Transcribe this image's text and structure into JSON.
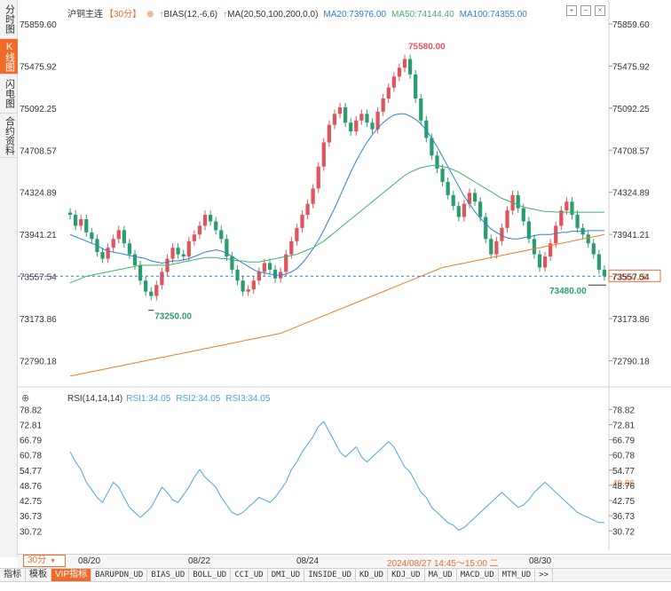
{
  "left_tabs": [
    {
      "label": "分时图",
      "active": false
    },
    {
      "label": "K线图",
      "active": true
    },
    {
      "label": "闪电图",
      "active": false
    },
    {
      "label": "合约资料",
      "active": false
    }
  ],
  "main_legend": {
    "title": "沪铜主连",
    "period": "【30分】",
    "bias": "BIAS(12,-6,6)",
    "ma": "MA(20,50,100,200,0,0)",
    "ma20": "MA20:73976.00",
    "ma50": "MA50:74144.40",
    "ma100": "MA100:74355.00"
  },
  "rsi_legend": {
    "name": "RSI(14,14,14)",
    "rsi1": "RSI1:34.05",
    "rsi2": "RSI2:34.05",
    "rsi3": "RSI3:34.05"
  },
  "colors": {
    "up": "#e0545d",
    "down": "#2a9d6f",
    "ma20": "#2b80d6",
    "ma50": "#3fb26a",
    "ma100": "#2b80d6",
    "ma200": "#f07c1f",
    "rsi": "#4aa3df",
    "accent": "#f06a2a"
  },
  "price_axis": [
    "75859.60",
    "75475.92",
    "75092.25",
    "74708.57",
    "74324.89",
    "73941.21",
    "73557.54",
    "73173.86",
    "72790.18"
  ],
  "rsi_axis": [
    "78.82",
    "72.81",
    "66.79",
    "60.78",
    "54.77",
    "48.76",
    "42.75",
    "36.73",
    "30.72"
  ],
  "current_price": "73560.00",
  "current_rsi": "49.86",
  "high_label": "75580.00",
  "low_label": "73250.00",
  "last_low_label": "73480.00",
  "dates": [
    "08/20",
    "08/22",
    "08/24",
    "08/30"
  ],
  "cursor_time": "2024/08/27  14:45～15:00 二",
  "period_button": "30分",
  "indicator_tabs": [
    {
      "label": "指标",
      "active": false
    },
    {
      "label": "模板",
      "active": false
    },
    {
      "label": "VIP指标",
      "active": true
    },
    {
      "label": "BARUPDN_UD",
      "active": false
    },
    {
      "label": "BIAS_UD",
      "active": false
    },
    {
      "label": "BOLL_UD",
      "active": false
    },
    {
      "label": "CCI_UD",
      "active": false
    },
    {
      "label": "DMI_UD",
      "active": false
    },
    {
      "label": "INSIDE_UD",
      "active": false
    },
    {
      "label": "KD_UD",
      "active": false
    },
    {
      "label": "KDJ_UD",
      "active": false
    },
    {
      "label": "MA_UD",
      "active": false
    },
    {
      "label": "MACD_UD",
      "active": false
    },
    {
      "label": "MTM_UD",
      "active": false
    },
    {
      "label": ">>",
      "active": false
    }
  ],
  "chart_data": {
    "type": "candlestick",
    "price_range": [
      72600,
      75900
    ],
    "candles_close": [
      74120,
      74020,
      74080,
      73960,
      73900,
      73780,
      73720,
      73820,
      73900,
      73980,
      73860,
      73760,
      73660,
      73520,
      73420,
      73380,
      73480,
      73600,
      73720,
      73820,
      73760,
      73740,
      73880,
      73940,
      74020,
      74120,
      74060,
      73980,
      73900,
      73740,
      73620,
      73520,
      73420,
      73440,
      73520,
      73600,
      73680,
      73620,
      73540,
      73600,
      73760,
      73880,
      74000,
      74120,
      74220,
      74360,
      74560,
      74780,
      74940,
      75040,
      75100,
      74960,
      74880,
      74980,
      75040,
      74960,
      74900,
      75060,
      75180,
      75280,
      75380,
      75460,
      75540,
      75400,
      75180,
      74980,
      74820,
      74660,
      74540,
      74420,
      74300,
      74200,
      74100,
      74220,
      74320,
      74240,
      74100,
      73900,
      73760,
      73880,
      74000,
      74160,
      74300,
      74180,
      74060,
      73900,
      73760,
      73640,
      73740,
      73860,
      74020,
      74160,
      74240,
      74120,
      74000,
      73940,
      73860,
      73760,
      73620,
      73560
    ],
    "ma20": [
      73940,
      73920,
      73900,
      73880,
      73860,
      73840,
      73810,
      73790,
      73780,
      73770,
      73760,
      73750,
      73740,
      73730,
      73720,
      73700,
      73690,
      73680,
      73690,
      73700,
      73700,
      73710,
      73720,
      73740,
      73760,
      73780,
      73790,
      73800,
      73790,
      73770,
      73740,
      73710,
      73680,
      73650,
      73620,
      73600,
      73590,
      73580,
      73570,
      73570,
      73580,
      73600,
      73630,
      73680,
      73740,
      73810,
      73890,
      73980,
      74080,
      74180,
      74290,
      74400,
      74510,
      74610,
      74700,
      74780,
      74850,
      74910,
      74960,
      75000,
      75030,
      75040,
      75040,
      75020,
      74990,
      74950,
      74890,
      74820,
      74740,
      74650,
      74560,
      74470,
      74380,
      74290,
      74220,
      74150,
      74090,
      74040,
      73990,
      73960,
      73930,
      73910,
      73900,
      73900,
      73910,
      73920,
      73930,
      73940,
      73940,
      73940,
      73950,
      73960,
      73960,
      73970,
      73970,
      73970,
      73976,
      73976,
      73976,
      73976
    ],
    "ma50": [
      73500,
      73520,
      73540,
      73560,
      73570,
      73580,
      73590,
      73600,
      73610,
      73620,
      73630,
      73640,
      73650,
      73660,
      73660,
      73660,
      73660,
      73660,
      73660,
      73670,
      73680,
      73690,
      73700,
      73710,
      73720,
      73730,
      73730,
      73730,
      73720,
      73720,
      73710,
      73700,
      73700,
      73690,
      73690,
      73690,
      73700,
      73710,
      73720,
      73730,
      73740,
      73750,
      73760,
      73780,
      73800,
      73820,
      73850,
      73880,
      73920,
      73960,
      74000,
      74040,
      74080,
      74120,
      74160,
      74200,
      74240,
      74280,
      74320,
      74360,
      74400,
      74440,
      74480,
      74510,
      74530,
      74550,
      74560,
      74570,
      74570,
      74560,
      74550,
      74530,
      74510,
      74480,
      74450,
      74420,
      74390,
      74360,
      74330,
      74300,
      74270,
      74250,
      74230,
      74210,
      74190,
      74180,
      74170,
      74160,
      74150,
      74150,
      74145,
      74145,
      74144,
      74144,
      74144,
      74144,
      74144,
      74144,
      74144,
      74144
    ],
    "ma200": [
      72650,
      72660,
      72670,
      72680,
      72690,
      72700,
      72710,
      72720,
      72730,
      72740,
      72750,
      72760,
      72770,
      72780,
      72790,
      72800,
      72810,
      72820,
      72830,
      72840,
      72850,
      72860,
      72870,
      72880,
      72890,
      72900,
      72910,
      72920,
      72930,
      72940,
      72950,
      72960,
      72970,
      72980,
      72990,
      73000,
      73010,
      73020,
      73030,
      73040,
      73060,
      73080,
      73100,
      73120,
      73140,
      73160,
      73180,
      73200,
      73220,
      73240,
      73260,
      73280,
      73300,
      73320,
      73340,
      73360,
      73380,
      73400,
      73420,
      73440,
      73460,
      73480,
      73500,
      73520,
      73540,
      73560,
      73580,
      73600,
      73620,
      73640,
      73650,
      73660,
      73670,
      73680,
      73690,
      73700,
      73710,
      73720,
      73730,
      73740,
      73750,
      73760,
      73770,
      73780,
      73790,
      73800,
      73810,
      73820,
      73830,
      73840,
      73850,
      73860,
      73870,
      73880,
      73890,
      73900,
      73910,
      73920,
      73930,
      73940
    ],
    "rsi": [
      62,
      58,
      55,
      50,
      47,
      44,
      42,
      46,
      50,
      48,
      44,
      40,
      38,
      36,
      38,
      40,
      44,
      48,
      46,
      43,
      42,
      45,
      48,
      52,
      55,
      52,
      50,
      48,
      44,
      41,
      38,
      37,
      38,
      40,
      42,
      44,
      43,
      42,
      44,
      47,
      50,
      55,
      58,
      62,
      65,
      68,
      72,
      74,
      70,
      66,
      62,
      60,
      62,
      64,
      60,
      58,
      60,
      62,
      64,
      66,
      64,
      60,
      56,
      54,
      50,
      46,
      44,
      40,
      38,
      36,
      34,
      33,
      31,
      32,
      34,
      36,
      38,
      40,
      42,
      44,
      46,
      44,
      42,
      40,
      41,
      43,
      46,
      48,
      50,
      48,
      46,
      44,
      42,
      40,
      38,
      37,
      36,
      35,
      34,
      34
    ],
    "rsi_range": [
      28,
      80
    ]
  }
}
